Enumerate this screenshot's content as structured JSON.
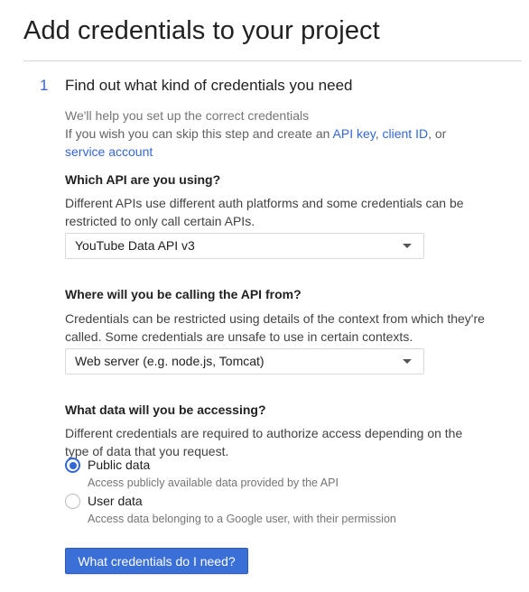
{
  "page": {
    "title": "Add credentials to your project"
  },
  "step": {
    "number": "1",
    "title": "Find out what kind of credentials you need"
  },
  "intro": {
    "line1": "We'll help you set up the correct credentials",
    "line2_prefix": "If you wish you can skip this step and create an ",
    "api_key_link": "API key",
    "sep1": ", ",
    "client_id_link": "client ID",
    "sep2": ", or",
    "service_account_link": "service account"
  },
  "api_section": {
    "heading": "Which API are you using?",
    "description": "Different APIs use different auth platforms and some credentials can be restricted to only call certain APIs.",
    "selected": "YouTube Data API v3"
  },
  "calling_section": {
    "heading": "Where will you be calling the API from?",
    "description": "Credentials can be restricted using details of the context from which they're called. Some credentials are unsafe to use in certain contexts.",
    "selected": "Web server (e.g. node.js, Tomcat)"
  },
  "data_section": {
    "heading": "What data will you be accessing?",
    "description": "Different credentials are required to authorize access depending on the type of data that you request.",
    "options": [
      {
        "label": "Public data",
        "description": "Access publicly available data provided by the API",
        "checked": true
      },
      {
        "label": "User data",
        "description": "Access data belonging to a Google user, with their permission",
        "checked": false
      }
    ]
  },
  "actions": {
    "submit_label": "What credentials do I need?"
  },
  "colors": {
    "accent": "#3367d6",
    "button": "#3b6fd8",
    "step_number": "#3b64c4"
  }
}
